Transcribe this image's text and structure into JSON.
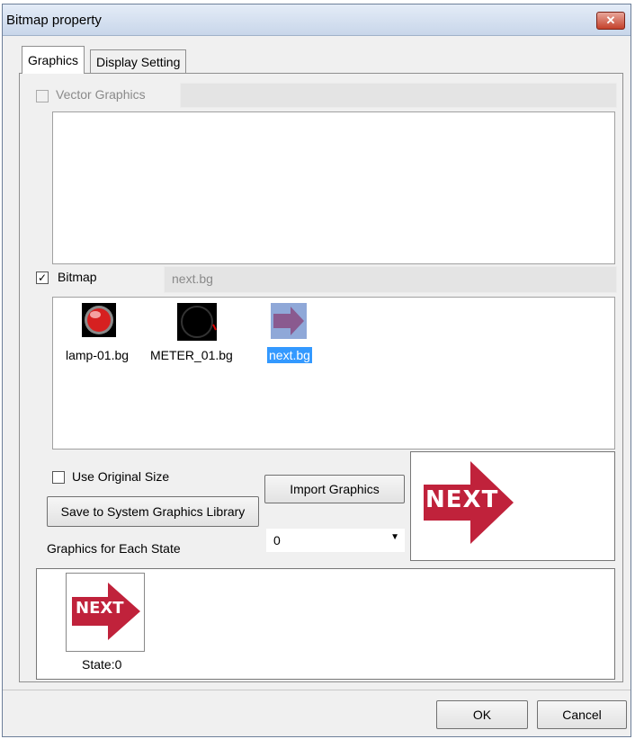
{
  "window": {
    "title": "Bitmap property",
    "close_glyph": "✕"
  },
  "tabs": [
    {
      "label": "Graphics",
      "active": true
    },
    {
      "label": "Display Setting",
      "active": false
    }
  ],
  "vector": {
    "label": "Vector Graphics",
    "checked": false,
    "enabled": false,
    "value": ""
  },
  "bitmap": {
    "label": "Bitmap",
    "checked": true,
    "value": "next.bg",
    "items": [
      {
        "name": "lamp-01.bg",
        "icon": "red-lamp-icon"
      },
      {
        "name": "METER_01.bg",
        "icon": "meter-icon"
      },
      {
        "name": "next.bg",
        "icon": "next-arrow-icon",
        "selected": true
      }
    ]
  },
  "options": {
    "use_original_size_label": "Use Original Size",
    "use_original_size_checked": false,
    "save_button": "Save to System Graphics Library",
    "import_button": "Import Graphics",
    "state_select_value": "0",
    "graphics_each_state_label": "Graphics for Each State"
  },
  "preview": {
    "text": "NEXT"
  },
  "states": [
    {
      "label": "State:0",
      "text": "NEXT"
    }
  ],
  "footer": {
    "ok": "OK",
    "cancel": "Cancel"
  },
  "colors": {
    "arrow": "#c0223b",
    "selection": "#3399ff",
    "titlebar": "#c8d6ea"
  }
}
